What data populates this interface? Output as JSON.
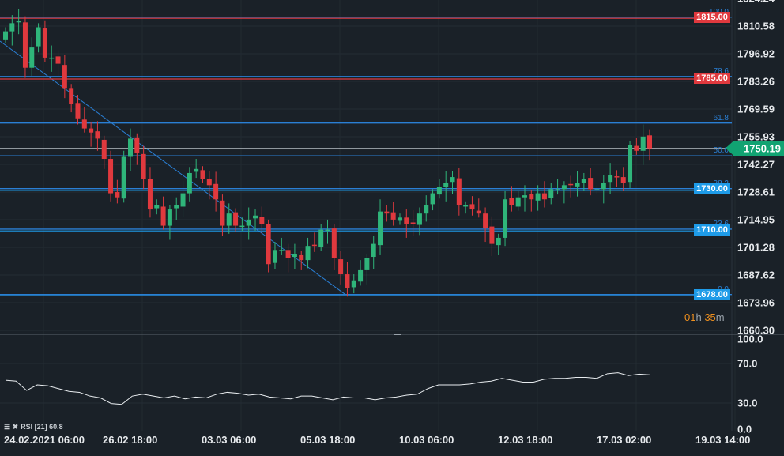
{
  "price_axis": [
    "1824.24",
    "1810.58",
    "1796.92",
    "1783.26",
    "1769.59",
    "1755.93",
    "1742.27",
    "1728.61",
    "1714.95",
    "1701.28",
    "1687.62",
    "1673.96",
    "1660.30"
  ],
  "rsi_axis": [
    "100.0",
    "70.0",
    "30.0",
    "0.0"
  ],
  "time_axis": [
    "24.02.2021 06:00",
    "26.02 18:00",
    "03.03 06:00",
    "05.03 18:00",
    "10.03 06:00",
    "12.03 18:00",
    "17.03 02:00",
    "19.03 14:00"
  ],
  "fib_levels": [
    {
      "label": "100.0",
      "price": 1815.0
    },
    {
      "label": "78.6",
      "price": 1785.7
    },
    {
      "label": "61.8",
      "price": 1762.7
    },
    {
      "label": "50.0",
      "price": 1746.5
    },
    {
      "label": "38.2",
      "price": 1730.3
    },
    {
      "label": "23.6",
      "price": 1710.3
    },
    {
      "label": "0.0",
      "price": 1678.0
    }
  ],
  "level_tags": [
    {
      "label": "1815.00",
      "price": 1815.0,
      "color": "#e0393e"
    },
    {
      "label": "1785.00",
      "price": 1785.0,
      "color": "#e0393e"
    },
    {
      "label": "1730.00",
      "price": 1730.0,
      "color": "#1e9be8"
    },
    {
      "label": "1710.00",
      "price": 1710.0,
      "color": "#1e9be8"
    },
    {
      "label": "1678.00",
      "price": 1678.0,
      "color": "#1e9be8"
    }
  ],
  "current_price": {
    "label": "1750.19",
    "price": 1750.19,
    "color": "#11a372"
  },
  "timer": {
    "hours": "01",
    "h": "h",
    "minutes": "35",
    "m": "m"
  },
  "rsi_legend": {
    "icons": "☰ ✖",
    "label": "RSI [21] 60.8"
  },
  "colors": {
    "up": "#2fb57a",
    "down": "#e0393e",
    "fib": "#2a7fd4",
    "bg": "#1a2128"
  },
  "chart_data": {
    "type": "candlestick",
    "symbol_scale": [
      1660.3,
      1824.24
    ],
    "closes": [
      1808,
      1812,
      1813,
      1790,
      1800,
      1810,
      1795,
      1795,
      1792,
      1780,
      1772,
      1765,
      1760,
      1758,
      1755,
      1745,
      1728,
      1726,
      1746,
      1755,
      1748,
      1735,
      1720,
      1722,
      1712,
      1720,
      1722,
      1728,
      1738,
      1740,
      1735,
      1732,
      1725,
      1712,
      1718,
      1712,
      1712,
      1715,
      1717,
      1713,
      1693,
      1700,
      1700,
      1696,
      1698,
      1695,
      1702,
      1702,
      1710,
      1710,
      1696,
      1688,
      1681,
      1685,
      1690,
      1696,
      1703,
      1719,
      1718,
      1715,
      1716,
      1713,
      1713,
      1718,
      1722,
      1728,
      1731,
      1733,
      1736,
      1722,
      1722,
      1720,
      1718,
      1711,
      1703,
      1706,
      1725,
      1722,
      1726,
      1727,
      1725,
      1728,
      1725,
      1730,
      1730,
      1732,
      1732,
      1733,
      1735,
      1730,
      1730,
      1733,
      1737,
      1736,
      1733,
      1752,
      1749,
      1756,
      1750.19
    ],
    "rsi": [
      55,
      54,
      44,
      50,
      49,
      46,
      43,
      42,
      38,
      36,
      30,
      29,
      38,
      40,
      38,
      36,
      38,
      35,
      37,
      36,
      40,
      42,
      41,
      39,
      40,
      37,
      36,
      35,
      38,
      38,
      36,
      34,
      37,
      36,
      36,
      34,
      36,
      37,
      39,
      40,
      46,
      50,
      50,
      50,
      51,
      53,
      54,
      57,
      55,
      53,
      53,
      56,
      57,
      57,
      58,
      58,
      57,
      62,
      63,
      60,
      61.5,
      60.8
    ],
    "rsi_range": [
      0,
      100
    ]
  }
}
